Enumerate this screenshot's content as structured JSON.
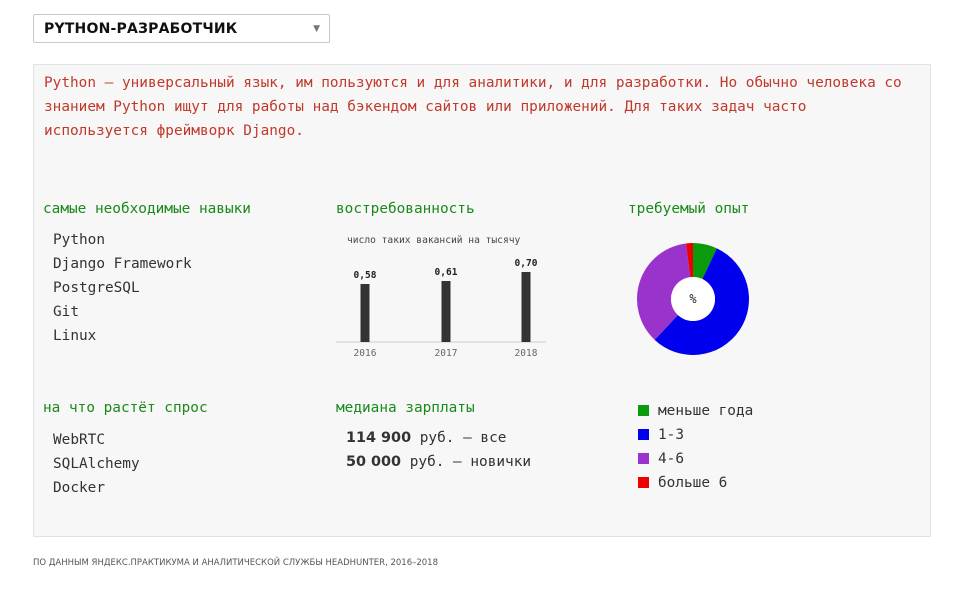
{
  "header": {
    "dropdown_value": "PYTHON-РАЗРАБОТЧИК",
    "caret": "▼"
  },
  "intro": "Python — универсальный язык, им пользуются и для аналитики, и для разработки. Но обычно человека со знанием Python ищут для работы над бэкендом сайтов или приложений. Для таких задач часто используется фреймворк Django.",
  "skills": {
    "heading": "самые необходимые навыки",
    "items": [
      "Python",
      "Django Framework",
      "PostgreSQL",
      "Git",
      "Linux"
    ]
  },
  "demand": {
    "heading": "востребованность",
    "caption": "число таких вакансий на тысячу"
  },
  "experience": {
    "heading": "требуемый опыт",
    "center_label": "%",
    "legend": [
      {
        "label": "меньше года",
        "color": "#0a9a0a"
      },
      {
        "label": "1-3",
        "color": "#0000ee"
      },
      {
        "label": "4-6",
        "color": "#9933cc"
      },
      {
        "label": "больше 6",
        "color": "#ee0000"
      }
    ]
  },
  "growth": {
    "heading": "на что растёт спрос",
    "items": [
      "WebRTC",
      "SQLAlchemy",
      "Docker"
    ]
  },
  "salary": {
    "heading": "медиана зарплаты",
    "all_value": "114 900",
    "all_suffix": " руб. — все",
    "junior_value": "50 000",
    "junior_suffix": " руб. — новички"
  },
  "footer": "ПО ДАННЫМ ЯНДЕКС.ПРАКТИКУМА И АНАЛИТИЧЕСКОЙ СЛУЖБЫ HEADHUNTER, 2016–2018",
  "chart_data": [
    {
      "type": "bar",
      "title": "",
      "xlabel": "",
      "ylabel": "число таких вакансий на тысячу",
      "categories": [
        "2016",
        "2017",
        "2018"
      ],
      "values": [
        0.58,
        0.61,
        0.7
      ],
      "value_labels": [
        "0,58",
        "0,61",
        "0,70"
      ],
      "ylim": [
        0,
        0.7
      ],
      "color": "#333333",
      "grid": false
    },
    {
      "type": "pie",
      "title": "",
      "labels": [
        "меньше года",
        "1-3",
        "4-6",
        "больше 6"
      ],
      "values": [
        7,
        55,
        36,
        2
      ],
      "colors": [
        "#0a9a0a",
        "#0000ee",
        "#9933cc",
        "#ee0000"
      ]
    }
  ]
}
